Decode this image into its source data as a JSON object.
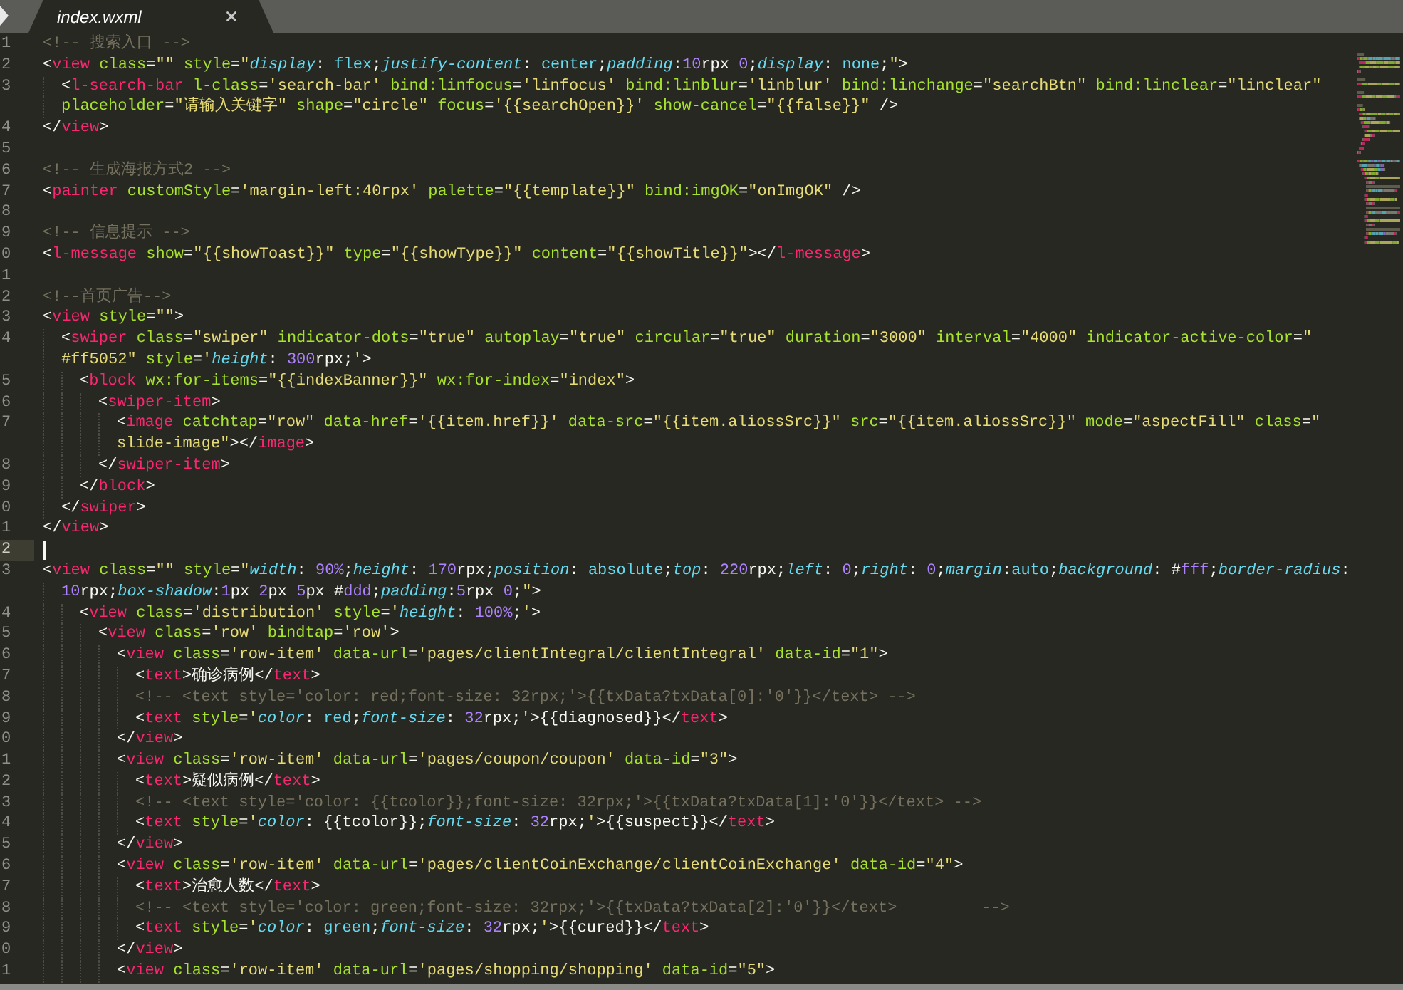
{
  "tab": {
    "title": "index.wxml",
    "selected": true
  },
  "lines": [
    {
      "number": "1",
      "current": false,
      "wraps": [
        {
          "tokens": [
            {
              "kind": "com",
              "text": "<!-- 搜索入口 -->"
            }
          ]
        }
      ]
    },
    {
      "number": "2",
      "current": false,
      "wraps": [
        {
          "tokens": [
            {
              "kind": "p",
              "text": "<"
            },
            {
              "kind": "tag",
              "text": "view"
            },
            {
              "kind": "attr",
              "text": " class"
            },
            {
              "kind": "p",
              "text": "="
            },
            {
              "kind": "str",
              "text": "\"\""
            },
            {
              "kind": "attr",
              "text": " style"
            },
            {
              "kind": "p",
              "text": "="
            },
            {
              "kind": "str",
              "text": "\""
            },
            {
              "kind": "prop",
              "text": "display"
            },
            {
              "kind": "p",
              "text": ": "
            },
            {
              "kind": "val",
              "text": "flex"
            },
            {
              "kind": "p",
              "text": ";"
            },
            {
              "kind": "prop",
              "text": "justify-content"
            },
            {
              "kind": "p",
              "text": ": "
            },
            {
              "kind": "val",
              "text": "center"
            },
            {
              "kind": "p",
              "text": ";"
            },
            {
              "kind": "prop",
              "text": "padding"
            },
            {
              "kind": "p",
              "text": ":"
            },
            {
              "kind": "num",
              "text": "10"
            },
            {
              "kind": "p",
              "text": "rpx "
            },
            {
              "kind": "num",
              "text": "0"
            },
            {
              "kind": "p",
              "text": ";"
            },
            {
              "kind": "prop",
              "text": "display"
            },
            {
              "kind": "p",
              "text": ": "
            },
            {
              "kind": "val",
              "text": "none"
            },
            {
              "kind": "p",
              "text": ";"
            },
            {
              "kind": "str",
              "text": "\""
            },
            {
              "kind": "p",
              "text": ">"
            }
          ]
        }
      ]
    },
    {
      "number": "3",
      "current": false,
      "wraps": [
        {
          "tokens": [
            {
              "kind": "p",
              "text": "\t<"
            },
            {
              "kind": "tag",
              "text": "l-search-bar"
            },
            {
              "kind": "attr",
              "text": " l-class"
            },
            {
              "kind": "p",
              "text": "="
            },
            {
              "kind": "str",
              "text": "'search-bar'"
            },
            {
              "kind": "attr",
              "text": " bind:linfocus"
            },
            {
              "kind": "p",
              "text": "="
            },
            {
              "kind": "str",
              "text": "'linfocus'"
            },
            {
              "kind": "attr",
              "text": " bind:linblur"
            },
            {
              "kind": "p",
              "text": "="
            },
            {
              "kind": "str",
              "text": "'linblur'"
            },
            {
              "kind": "attr",
              "text": " bind:linchange"
            },
            {
              "kind": "p",
              "text": "="
            },
            {
              "kind": "str",
              "text": "\"searchBtn\""
            },
            {
              "kind": "attr",
              "text": " bind:linclear"
            },
            {
              "kind": "p",
              "text": "="
            },
            {
              "kind": "str",
              "text": "\"linclear\""
            }
          ]
        },
        {
          "tokens": [
            {
              "kind": "attr",
              "text": "\tplaceholder"
            },
            {
              "kind": "p",
              "text": "="
            },
            {
              "kind": "str",
              "text": "\"请输入关键字\""
            },
            {
              "kind": "attr",
              "text": " shape"
            },
            {
              "kind": "p",
              "text": "="
            },
            {
              "kind": "str",
              "text": "\"circle\""
            },
            {
              "kind": "attr",
              "text": " focus"
            },
            {
              "kind": "p",
              "text": "="
            },
            {
              "kind": "str",
              "text": "'{{searchOpen}}'"
            },
            {
              "kind": "attr",
              "text": " show-cancel"
            },
            {
              "kind": "p",
              "text": "="
            },
            {
              "kind": "str",
              "text": "\"{{false}}\""
            },
            {
              "kind": "p",
              "text": " />"
            }
          ]
        }
      ]
    },
    {
      "number": "4",
      "current": false,
      "wraps": [
        {
          "tokens": [
            {
              "kind": "p",
              "text": "</"
            },
            {
              "kind": "tag",
              "text": "view"
            },
            {
              "kind": "p",
              "text": ">"
            }
          ]
        }
      ]
    },
    {
      "number": "5",
      "current": false
    },
    {
      "number": "6",
      "current": false,
      "wraps": [
        {
          "tokens": [
            {
              "kind": "com",
              "text": "<!-- 生成海报方式2 -->"
            }
          ]
        }
      ]
    },
    {
      "number": "7",
      "current": false,
      "wraps": [
        {
          "tokens": [
            {
              "kind": "p",
              "text": "<"
            },
            {
              "kind": "tag",
              "text": "painter"
            },
            {
              "kind": "attr",
              "text": " customStyle"
            },
            {
              "kind": "p",
              "text": "="
            },
            {
              "kind": "str",
              "text": "'margin-left:40rpx'"
            },
            {
              "kind": "attr",
              "text": " palette"
            },
            {
              "kind": "p",
              "text": "="
            },
            {
              "kind": "str",
              "text": "\"{{template}}\""
            },
            {
              "kind": "attr",
              "text": " bind:imgOK"
            },
            {
              "kind": "p",
              "text": "="
            },
            {
              "kind": "str",
              "text": "\"onImgOK\""
            },
            {
              "kind": "p",
              "text": " />"
            }
          ]
        }
      ]
    },
    {
      "number": "8",
      "current": false
    },
    {
      "number": "9",
      "current": false,
      "wraps": [
        {
          "tokens": [
            {
              "kind": "com",
              "text": "<!-- 信息提示 -->"
            }
          ]
        }
      ]
    },
    {
      "number": "0",
      "current": false,
      "wraps": [
        {
          "tokens": [
            {
              "kind": "p",
              "text": "<"
            },
            {
              "kind": "tag",
              "text": "l-message"
            },
            {
              "kind": "attr",
              "text": " show"
            },
            {
              "kind": "p",
              "text": "="
            },
            {
              "kind": "str",
              "text": "\"{{showToast}}\""
            },
            {
              "kind": "attr",
              "text": " type"
            },
            {
              "kind": "p",
              "text": "="
            },
            {
              "kind": "str",
              "text": "\"{{showType}}\""
            },
            {
              "kind": "attr",
              "text": " content"
            },
            {
              "kind": "p",
              "text": "="
            },
            {
              "kind": "str",
              "text": "\"{{showTitle}}\""
            },
            {
              "kind": "p",
              "text": "></"
            },
            {
              "kind": "tag",
              "text": "l-message"
            },
            {
              "kind": "p",
              "text": ">"
            }
          ]
        }
      ]
    },
    {
      "number": "1",
      "current": false
    },
    {
      "number": "2",
      "current": false,
      "wraps": [
        {
          "tokens": [
            {
              "kind": "com",
              "text": "<!--首页广告-->"
            }
          ]
        }
      ]
    },
    {
      "number": "3",
      "current": false,
      "wraps": [
        {
          "tokens": [
            {
              "kind": "p",
              "text": "<"
            },
            {
              "kind": "tag",
              "text": "view"
            },
            {
              "kind": "attr",
              "text": " style"
            },
            {
              "kind": "p",
              "text": "="
            },
            {
              "kind": "str",
              "text": "\"\""
            },
            {
              "kind": "p",
              "text": ">"
            }
          ]
        }
      ]
    },
    {
      "number": "4",
      "current": false,
      "wraps": [
        {
          "tokens": [
            {
              "kind": "p",
              "text": "\t<"
            },
            {
              "kind": "tag",
              "text": "swiper"
            },
            {
              "kind": "attr",
              "text": " class"
            },
            {
              "kind": "p",
              "text": "="
            },
            {
              "kind": "str",
              "text": "\"swiper\""
            },
            {
              "kind": "attr",
              "text": " indicator-dots"
            },
            {
              "kind": "p",
              "text": "="
            },
            {
              "kind": "str",
              "text": "\"true\""
            },
            {
              "kind": "attr",
              "text": " autoplay"
            },
            {
              "kind": "p",
              "text": "="
            },
            {
              "kind": "str",
              "text": "\"true\""
            },
            {
              "kind": "attr",
              "text": " circular"
            },
            {
              "kind": "p",
              "text": "="
            },
            {
              "kind": "str",
              "text": "\"true\""
            },
            {
              "kind": "attr",
              "text": " duration"
            },
            {
              "kind": "p",
              "text": "="
            },
            {
              "kind": "str",
              "text": "\"3000\""
            },
            {
              "kind": "attr",
              "text": " interval"
            },
            {
              "kind": "p",
              "text": "="
            },
            {
              "kind": "str",
              "text": "\"4000\""
            },
            {
              "kind": "attr",
              "text": " indicator-active-color"
            },
            {
              "kind": "p",
              "text": "="
            },
            {
              "kind": "str",
              "text": "\""
            }
          ]
        },
        {
          "tokens": [
            {
              "kind": "str",
              "text": "\t#ff5052\""
            },
            {
              "kind": "attr",
              "text": " style"
            },
            {
              "kind": "p",
              "text": "="
            },
            {
              "kind": "str",
              "text": "'"
            },
            {
              "kind": "prop",
              "text": "height"
            },
            {
              "kind": "p",
              "text": ": "
            },
            {
              "kind": "num",
              "text": "300"
            },
            {
              "kind": "p",
              "text": "rpx;"
            },
            {
              "kind": "str",
              "text": "'"
            },
            {
              "kind": "p",
              "text": ">"
            }
          ]
        }
      ]
    },
    {
      "number": "5",
      "current": false,
      "wraps": [
        {
          "tokens": [
            {
              "kind": "p",
              "text": "\t\t<"
            },
            {
              "kind": "tag",
              "text": "block"
            },
            {
              "kind": "attr",
              "text": " wx:for-items"
            },
            {
              "kind": "p",
              "text": "="
            },
            {
              "kind": "str",
              "text": "\"{{indexBanner}}\""
            },
            {
              "kind": "attr",
              "text": " wx:for-index"
            },
            {
              "kind": "p",
              "text": "="
            },
            {
              "kind": "str",
              "text": "\"index\""
            },
            {
              "kind": "p",
              "text": ">"
            }
          ]
        }
      ]
    },
    {
      "number": "6",
      "current": false,
      "wraps": [
        {
          "tokens": [
            {
              "kind": "p",
              "text": "\t\t\t<"
            },
            {
              "kind": "tag",
              "text": "swiper-item"
            },
            {
              "kind": "p",
              "text": ">"
            }
          ]
        }
      ]
    },
    {
      "number": "7",
      "current": false,
      "wraps": [
        {
          "tokens": [
            {
              "kind": "p",
              "text": "\t\t\t\t<"
            },
            {
              "kind": "tag",
              "text": "image"
            },
            {
              "kind": "attr",
              "text": " catchtap"
            },
            {
              "kind": "p",
              "text": "="
            },
            {
              "kind": "str",
              "text": "\"row\""
            },
            {
              "kind": "attr",
              "text": " data-href"
            },
            {
              "kind": "p",
              "text": "="
            },
            {
              "kind": "str",
              "text": "'{{item.href}}'"
            },
            {
              "kind": "attr",
              "text": " data-src"
            },
            {
              "kind": "p",
              "text": "="
            },
            {
              "kind": "str",
              "text": "\"{{item.aliossSrc}}\""
            },
            {
              "kind": "attr",
              "text": " src"
            },
            {
              "kind": "p",
              "text": "="
            },
            {
              "kind": "str",
              "text": "\"{{item.aliossSrc}}\""
            },
            {
              "kind": "attr",
              "text": " mode"
            },
            {
              "kind": "p",
              "text": "="
            },
            {
              "kind": "str",
              "text": "\"aspectFill\""
            },
            {
              "kind": "attr",
              "text": " class"
            },
            {
              "kind": "p",
              "text": "="
            },
            {
              "kind": "str",
              "text": "\""
            }
          ]
        },
        {
          "tokens": [
            {
              "kind": "str",
              "text": "\t\t\t\tslide-image\""
            },
            {
              "kind": "p",
              "text": "></"
            },
            {
              "kind": "tag",
              "text": "image"
            },
            {
              "kind": "p",
              "text": ">"
            }
          ]
        }
      ]
    },
    {
      "number": "8",
      "current": false,
      "wraps": [
        {
          "tokens": [
            {
              "kind": "p",
              "text": "\t\t\t</"
            },
            {
              "kind": "tag",
              "text": "swiper-item"
            },
            {
              "kind": "p",
              "text": ">"
            }
          ]
        }
      ]
    },
    {
      "number": "9",
      "current": false,
      "wraps": [
        {
          "tokens": [
            {
              "kind": "p",
              "text": "\t\t</"
            },
            {
              "kind": "tag",
              "text": "block"
            },
            {
              "kind": "p",
              "text": ">"
            }
          ]
        }
      ]
    },
    {
      "number": "0",
      "current": false,
      "wraps": [
        {
          "tokens": [
            {
              "kind": "p",
              "text": "\t</"
            },
            {
              "kind": "tag",
              "text": "swiper"
            },
            {
              "kind": "p",
              "text": ">"
            }
          ]
        }
      ]
    },
    {
      "number": "1",
      "current": false,
      "wraps": [
        {
          "tokens": [
            {
              "kind": "p",
              "text": "</"
            },
            {
              "kind": "tag",
              "text": "view"
            },
            {
              "kind": "p",
              "text": ">"
            }
          ]
        }
      ]
    },
    {
      "number": "2",
      "current": true
    },
    {
      "number": "3",
      "current": false,
      "wraps": [
        {
          "tokens": [
            {
              "kind": "p",
              "text": "<"
            },
            {
              "kind": "tag",
              "text": "view"
            },
            {
              "kind": "attr",
              "text": " class"
            },
            {
              "kind": "p",
              "text": "="
            },
            {
              "kind": "str",
              "text": "\"\""
            },
            {
              "kind": "attr",
              "text": " style"
            },
            {
              "kind": "p",
              "text": "="
            },
            {
              "kind": "str",
              "text": "\""
            },
            {
              "kind": "prop",
              "text": "width"
            },
            {
              "kind": "p",
              "text": ": "
            },
            {
              "kind": "num",
              "text": "90%"
            },
            {
              "kind": "p",
              "text": ";"
            },
            {
              "kind": "prop",
              "text": "height"
            },
            {
              "kind": "p",
              "text": ": "
            },
            {
              "kind": "num",
              "text": "170"
            },
            {
              "kind": "p",
              "text": "rpx;"
            },
            {
              "kind": "prop",
              "text": "position"
            },
            {
              "kind": "p",
              "text": ": "
            },
            {
              "kind": "val",
              "text": "absolute"
            },
            {
              "kind": "p",
              "text": ";"
            },
            {
              "kind": "prop",
              "text": "top"
            },
            {
              "kind": "p",
              "text": ": "
            },
            {
              "kind": "num",
              "text": "220"
            },
            {
              "kind": "p",
              "text": "rpx;"
            },
            {
              "kind": "prop",
              "text": "left"
            },
            {
              "kind": "p",
              "text": ": "
            },
            {
              "kind": "num",
              "text": "0"
            },
            {
              "kind": "p",
              "text": ";"
            },
            {
              "kind": "prop",
              "text": "right"
            },
            {
              "kind": "p",
              "text": ": "
            },
            {
              "kind": "num",
              "text": "0"
            },
            {
              "kind": "p",
              "text": ";"
            },
            {
              "kind": "prop",
              "text": "margin"
            },
            {
              "kind": "p",
              "text": ":"
            },
            {
              "kind": "val",
              "text": "auto"
            },
            {
              "kind": "p",
              "text": ";"
            },
            {
              "kind": "prop",
              "text": "background"
            },
            {
              "kind": "p",
              "text": ": #"
            },
            {
              "kind": "num",
              "text": "fff"
            },
            {
              "kind": "p",
              "text": ";"
            },
            {
              "kind": "prop",
              "text": "border-radius"
            },
            {
              "kind": "p",
              "text": ":"
            }
          ]
        },
        {
          "tokens": [
            {
              "kind": "num",
              "text": "\t10"
            },
            {
              "kind": "p",
              "text": "rpx;"
            },
            {
              "kind": "prop",
              "text": "box-shadow"
            },
            {
              "kind": "p",
              "text": ":"
            },
            {
              "kind": "num",
              "text": "1"
            },
            {
              "kind": "p",
              "text": "px "
            },
            {
              "kind": "num",
              "text": "2"
            },
            {
              "kind": "p",
              "text": "px "
            },
            {
              "kind": "num",
              "text": "5"
            },
            {
              "kind": "p",
              "text": "px #"
            },
            {
              "kind": "num",
              "text": "ddd"
            },
            {
              "kind": "p",
              "text": ";"
            },
            {
              "kind": "prop",
              "text": "padding"
            },
            {
              "kind": "p",
              "text": ":"
            },
            {
              "kind": "num",
              "text": "5"
            },
            {
              "kind": "p",
              "text": "rpx "
            },
            {
              "kind": "num",
              "text": "0"
            },
            {
              "kind": "p",
              "text": ";"
            },
            {
              "kind": "str",
              "text": "\""
            },
            {
              "kind": "p",
              "text": ">"
            }
          ]
        }
      ]
    },
    {
      "number": "4",
      "current": false,
      "wraps": [
        {
          "tokens": [
            {
              "kind": "p",
              "text": "\t\t<"
            },
            {
              "kind": "tag",
              "text": "view"
            },
            {
              "kind": "attr",
              "text": " class"
            },
            {
              "kind": "p",
              "text": "="
            },
            {
              "kind": "str",
              "text": "'distribution'"
            },
            {
              "kind": "attr",
              "text": " style"
            },
            {
              "kind": "p",
              "text": "="
            },
            {
              "kind": "str",
              "text": "'"
            },
            {
              "kind": "prop",
              "text": "height"
            },
            {
              "kind": "p",
              "text": ": "
            },
            {
              "kind": "num",
              "text": "100%"
            },
            {
              "kind": "p",
              "text": ";"
            },
            {
              "kind": "str",
              "text": "'"
            },
            {
              "kind": "p",
              "text": ">"
            }
          ]
        }
      ]
    },
    {
      "number": "5",
      "current": false,
      "wraps": [
        {
          "tokens": [
            {
              "kind": "p",
              "text": "\t\t\t<"
            },
            {
              "kind": "tag",
              "text": "view"
            },
            {
              "kind": "attr",
              "text": " class"
            },
            {
              "kind": "p",
              "text": "="
            },
            {
              "kind": "str",
              "text": "'row'"
            },
            {
              "kind": "attr",
              "text": " bindtap"
            },
            {
              "kind": "p",
              "text": "="
            },
            {
              "kind": "str",
              "text": "'row'"
            },
            {
              "kind": "p",
              "text": ">"
            }
          ]
        }
      ]
    },
    {
      "number": "6",
      "current": false,
      "wraps": [
        {
          "tokens": [
            {
              "kind": "p",
              "text": "\t\t\t\t<"
            },
            {
              "kind": "tag",
              "text": "view"
            },
            {
              "kind": "attr",
              "text": " class"
            },
            {
              "kind": "p",
              "text": "="
            },
            {
              "kind": "str",
              "text": "'row-item'"
            },
            {
              "kind": "attr",
              "text": " data-url"
            },
            {
              "kind": "p",
              "text": "="
            },
            {
              "kind": "str",
              "text": "'pages/clientIntegral/clientIntegral'"
            },
            {
              "kind": "attr",
              "text": " data-id"
            },
            {
              "kind": "p",
              "text": "="
            },
            {
              "kind": "str",
              "text": "\"1\""
            },
            {
              "kind": "p",
              "text": ">"
            }
          ]
        }
      ]
    },
    {
      "number": "7",
      "current": false,
      "wraps": [
        {
          "tokens": [
            {
              "kind": "p",
              "text": "\t\t\t\t\t<"
            },
            {
              "kind": "tag",
              "text": "text"
            },
            {
              "kind": "p",
              "text": ">确诊病例</"
            },
            {
              "kind": "tag",
              "text": "text"
            },
            {
              "kind": "p",
              "text": ">"
            }
          ]
        }
      ]
    },
    {
      "number": "8",
      "current": false,
      "wraps": [
        {
          "tokens": [
            {
              "kind": "com",
              "text": "\t\t\t\t\t<!-- <text style='color: red;font-size: 32rpx;'>{{txData?txData[0]:'0'}}</text> -->"
            }
          ]
        }
      ]
    },
    {
      "number": "9",
      "current": false,
      "wraps": [
        {
          "tokens": [
            {
              "kind": "p",
              "text": "\t\t\t\t\t<"
            },
            {
              "kind": "tag",
              "text": "text"
            },
            {
              "kind": "attr",
              "text": " style"
            },
            {
              "kind": "p",
              "text": "="
            },
            {
              "kind": "str",
              "text": "'"
            },
            {
              "kind": "prop",
              "text": "color"
            },
            {
              "kind": "p",
              "text": ": "
            },
            {
              "kind": "val",
              "text": "red"
            },
            {
              "kind": "p",
              "text": ";"
            },
            {
              "kind": "prop",
              "text": "font-size"
            },
            {
              "kind": "p",
              "text": ": "
            },
            {
              "kind": "num",
              "text": "32"
            },
            {
              "kind": "p",
              "text": "rpx;"
            },
            {
              "kind": "str",
              "text": "'"
            },
            {
              "kind": "p",
              "text": ">{{diagnosed}}</"
            },
            {
              "kind": "tag",
              "text": "text"
            },
            {
              "kind": "p",
              "text": ">"
            }
          ]
        }
      ]
    },
    {
      "number": "0",
      "current": false,
      "wraps": [
        {
          "tokens": [
            {
              "kind": "p",
              "text": "\t\t\t\t</"
            },
            {
              "kind": "tag",
              "text": "view"
            },
            {
              "kind": "p",
              "text": ">"
            }
          ]
        }
      ]
    },
    {
      "number": "1",
      "current": false,
      "wraps": [
        {
          "tokens": [
            {
              "kind": "p",
              "text": "\t\t\t\t<"
            },
            {
              "kind": "tag",
              "text": "view"
            },
            {
              "kind": "attr",
              "text": " class"
            },
            {
              "kind": "p",
              "text": "="
            },
            {
              "kind": "str",
              "text": "'row-item'"
            },
            {
              "kind": "attr",
              "text": " data-url"
            },
            {
              "kind": "p",
              "text": "="
            },
            {
              "kind": "str",
              "text": "'pages/coupon/coupon'"
            },
            {
              "kind": "attr",
              "text": " data-id"
            },
            {
              "kind": "p",
              "text": "="
            },
            {
              "kind": "str",
              "text": "\"3\""
            },
            {
              "kind": "p",
              "text": ">"
            }
          ]
        }
      ]
    },
    {
      "number": "2",
      "current": false,
      "wraps": [
        {
          "tokens": [
            {
              "kind": "p",
              "text": "\t\t\t\t\t<"
            },
            {
              "kind": "tag",
              "text": "text"
            },
            {
              "kind": "p",
              "text": ">疑似病例</"
            },
            {
              "kind": "tag",
              "text": "text"
            },
            {
              "kind": "p",
              "text": ">"
            }
          ]
        }
      ]
    },
    {
      "number": "3",
      "current": false,
      "wraps": [
        {
          "tokens": [
            {
              "kind": "com",
              "text": "\t\t\t\t\t<!-- <text style='color: {{tcolor}};font-size: 32rpx;'>{{txData?txData[1]:'0'}}</text> -->"
            }
          ]
        }
      ]
    },
    {
      "number": "4",
      "current": false,
      "wraps": [
        {
          "tokens": [
            {
              "kind": "p",
              "text": "\t\t\t\t\t<"
            },
            {
              "kind": "tag",
              "text": "text"
            },
            {
              "kind": "attr",
              "text": " style"
            },
            {
              "kind": "p",
              "text": "="
            },
            {
              "kind": "str",
              "text": "'"
            },
            {
              "kind": "prop",
              "text": "color"
            },
            {
              "kind": "p",
              "text": ": {{tcolor}};"
            },
            {
              "kind": "prop",
              "text": "font-size"
            },
            {
              "kind": "p",
              "text": ": "
            },
            {
              "kind": "num",
              "text": "32"
            },
            {
              "kind": "p",
              "text": "rpx;"
            },
            {
              "kind": "str",
              "text": "'"
            },
            {
              "kind": "p",
              "text": ">{{suspect}}</"
            },
            {
              "kind": "tag",
              "text": "text"
            },
            {
              "kind": "p",
              "text": ">"
            }
          ]
        }
      ]
    },
    {
      "number": "5",
      "current": false,
      "wraps": [
        {
          "tokens": [
            {
              "kind": "p",
              "text": "\t\t\t\t</"
            },
            {
              "kind": "tag",
              "text": "view"
            },
            {
              "kind": "p",
              "text": ">"
            }
          ]
        }
      ]
    },
    {
      "number": "6",
      "current": false,
      "wraps": [
        {
          "tokens": [
            {
              "kind": "p",
              "text": "\t\t\t\t<"
            },
            {
              "kind": "tag",
              "text": "view"
            },
            {
              "kind": "attr",
              "text": " class"
            },
            {
              "kind": "p",
              "text": "="
            },
            {
              "kind": "str",
              "text": "'row-item'"
            },
            {
              "kind": "attr",
              "text": " data-url"
            },
            {
              "kind": "p",
              "text": "="
            },
            {
              "kind": "str",
              "text": "'pages/clientCoinExchange/clientCoinExchange'"
            },
            {
              "kind": "attr",
              "text": " data-id"
            },
            {
              "kind": "p",
              "text": "="
            },
            {
              "kind": "str",
              "text": "\"4\""
            },
            {
              "kind": "p",
              "text": ">"
            }
          ]
        }
      ]
    },
    {
      "number": "7",
      "current": false,
      "wraps": [
        {
          "tokens": [
            {
              "kind": "p",
              "text": "\t\t\t\t\t<"
            },
            {
              "kind": "tag",
              "text": "text"
            },
            {
              "kind": "p",
              "text": ">治愈人数</"
            },
            {
              "kind": "tag",
              "text": "text"
            },
            {
              "kind": "p",
              "text": ">"
            }
          ]
        }
      ]
    },
    {
      "number": "8",
      "current": false,
      "wraps": [
        {
          "tokens": [
            {
              "kind": "com",
              "text": "\t\t\t\t\t<!-- <text style='color: green;font-size: 32rpx;'>{{txData?txData[2]:'0'}}</text>         -->"
            }
          ]
        }
      ]
    },
    {
      "number": "9",
      "current": false,
      "wraps": [
        {
          "tokens": [
            {
              "kind": "p",
              "text": "\t\t\t\t\t<"
            },
            {
              "kind": "tag",
              "text": "text"
            },
            {
              "kind": "attr",
              "text": " style"
            },
            {
              "kind": "p",
              "text": "="
            },
            {
              "kind": "str",
              "text": "'"
            },
            {
              "kind": "prop",
              "text": "color"
            },
            {
              "kind": "p",
              "text": ": "
            },
            {
              "kind": "val",
              "text": "green"
            },
            {
              "kind": "p",
              "text": ";"
            },
            {
              "kind": "prop",
              "text": "font-size"
            },
            {
              "kind": "p",
              "text": ": "
            },
            {
              "kind": "num",
              "text": "32"
            },
            {
              "kind": "p",
              "text": "rpx;"
            },
            {
              "kind": "str",
              "text": "'"
            },
            {
              "kind": "p",
              "text": ">{{cured}}</"
            },
            {
              "kind": "tag",
              "text": "text"
            },
            {
              "kind": "p",
              "text": ">"
            }
          ]
        }
      ]
    },
    {
      "number": "0",
      "current": false,
      "wraps": [
        {
          "tokens": [
            {
              "kind": "p",
              "text": "\t\t\t\t</"
            },
            {
              "kind": "tag",
              "text": "view"
            },
            {
              "kind": "p",
              "text": ">"
            }
          ]
        }
      ]
    },
    {
      "number": "1",
      "current": false,
      "wraps": [
        {
          "tokens": [
            {
              "kind": "p",
              "text": "\t\t\t\t<"
            },
            {
              "kind": "tag",
              "text": "view"
            },
            {
              "kind": "attr",
              "text": " class"
            },
            {
              "kind": "p",
              "text": "="
            },
            {
              "kind": "str",
              "text": "'row-item'"
            },
            {
              "kind": "attr",
              "text": " data-url"
            },
            {
              "kind": "p",
              "text": "="
            },
            {
              "kind": "str",
              "text": "'pages/shopping/shopping'"
            },
            {
              "kind": "attr",
              "text": " data-id"
            },
            {
              "kind": "p",
              "text": "="
            },
            {
              "kind": "str",
              "text": "\"5\""
            },
            {
              "kind": "p",
              "text": ">"
            }
          ]
        }
      ]
    }
  ]
}
